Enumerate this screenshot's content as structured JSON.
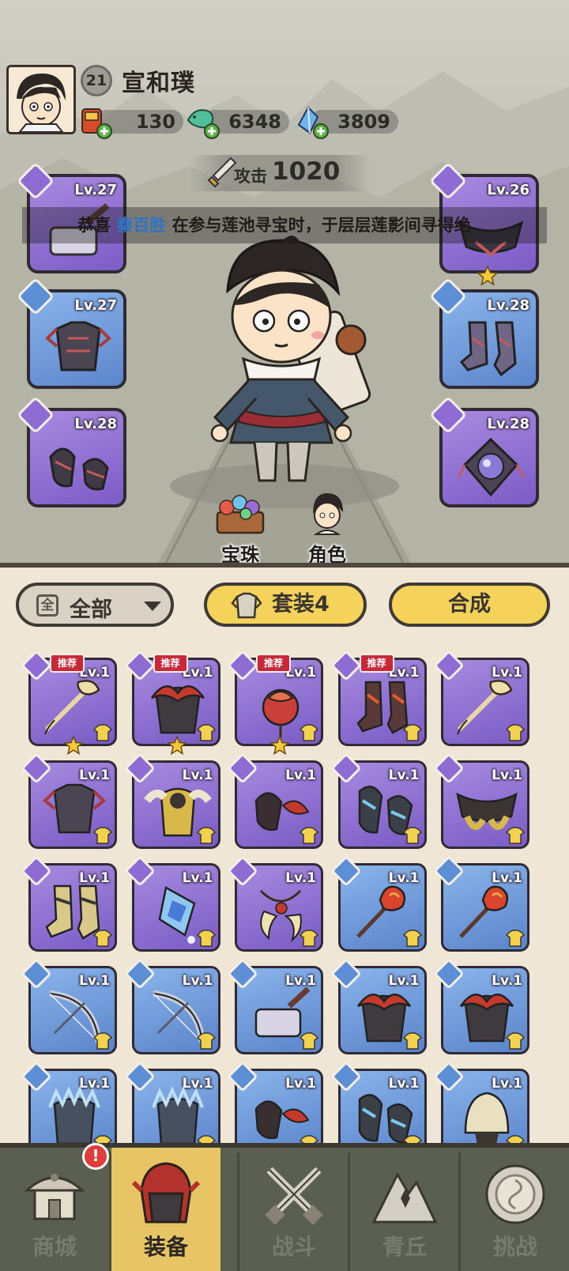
{
  "player": {
    "level": "21",
    "name": "宣和璞",
    "avatar_icon": "hero-portrait-icon"
  },
  "resources": [
    {
      "name": "scroll-bag",
      "value": "130",
      "icon": "red-scroll-bag-icon"
    },
    {
      "name": "jade-dragon",
      "value": "6348",
      "icon": "jade-dragon-icon"
    },
    {
      "name": "crystal",
      "value": "3809",
      "icon": "blue-crystal-icon"
    }
  ],
  "attack": {
    "label": "攻击",
    "value": "1020"
  },
  "broadcast": {
    "prefix": "恭喜",
    "player": "秦百胜",
    "message": "在参与莲池寻宝时，于层层莲影间寻得绝"
  },
  "equipped": {
    "left": [
      {
        "level": "Lv.27",
        "slot": "weapon",
        "item": "purple-hammer"
      },
      {
        "level": "Lv.27",
        "slot": "armor",
        "item": "dark-chest-armor"
      },
      {
        "level": "Lv.28",
        "slot": "bracer",
        "item": "dark-bracer"
      }
    ],
    "right": [
      {
        "level": "Lv.26",
        "slot": "belt",
        "item": "dark-belt",
        "starred": true
      },
      {
        "level": "Lv.28",
        "slot": "boots",
        "item": "dark-boots"
      },
      {
        "level": "Lv.28",
        "slot": "amulet",
        "item": "orb-amulet"
      }
    ]
  },
  "shortcuts": {
    "gems": "宝珠",
    "character": "角色"
  },
  "filters": {
    "all_icon_text": "全",
    "all_label": "全部",
    "set_label": "套装4",
    "craft_label": "合成"
  },
  "inventory": [
    {
      "level": "Lv.1",
      "rarity": "purple",
      "item": "gold-staff",
      "recommended": "推荐",
      "starred": true
    },
    {
      "level": "Lv.1",
      "rarity": "purple",
      "item": "red-flower-armor",
      "recommended": "推荐",
      "starred": true
    },
    {
      "level": "Lv.1",
      "rarity": "purple",
      "item": "red-lotus-amulet",
      "recommended": "推荐",
      "starred": true
    },
    {
      "level": "Lv.1",
      "rarity": "purple",
      "item": "flame-boots",
      "recommended": "推荐",
      "starred": false
    },
    {
      "level": "Lv.1",
      "rarity": "purple",
      "item": "gold-staff",
      "recommended": "",
      "starred": false
    },
    {
      "level": "Lv.1",
      "rarity": "purple",
      "item": "dark-chest-armor",
      "recommended": "",
      "starred": false
    },
    {
      "level": "Lv.1",
      "rarity": "purple",
      "item": "gold-feather-armor",
      "recommended": "",
      "starred": false
    },
    {
      "level": "Lv.1",
      "rarity": "purple",
      "item": "red-bracer",
      "recommended": "",
      "starred": false
    },
    {
      "level": "Lv.1",
      "rarity": "purple",
      "item": "ice-bracer",
      "recommended": "",
      "starred": false
    },
    {
      "level": "Lv.1",
      "rarity": "purple",
      "item": "gold-belt",
      "recommended": "",
      "starred": false
    },
    {
      "level": "Lv.1",
      "rarity": "purple",
      "item": "gold-boots",
      "recommended": "",
      "starred": false
    },
    {
      "level": "Lv.1",
      "rarity": "purple",
      "item": "ice-jade-pendant",
      "recommended": "",
      "starred": false
    },
    {
      "level": "Lv.1",
      "rarity": "purple",
      "item": "horn-necklace",
      "recommended": "",
      "starred": false
    },
    {
      "level": "Lv.1",
      "rarity": "blue",
      "item": "flame-staff",
      "recommended": "",
      "starred": false
    },
    {
      "level": "Lv.1",
      "rarity": "blue",
      "item": "flame-staff",
      "recommended": "",
      "starred": false
    },
    {
      "level": "Lv.1",
      "rarity": "blue",
      "item": "silver-bow",
      "recommended": "",
      "starred": false
    },
    {
      "level": "Lv.1",
      "rarity": "blue",
      "item": "silver-bow",
      "recommended": "",
      "starred": false
    },
    {
      "level": "Lv.1",
      "rarity": "blue",
      "item": "stone-hammer",
      "recommended": "",
      "starred": false
    },
    {
      "level": "Lv.1",
      "rarity": "blue",
      "item": "red-flower-armor",
      "recommended": "",
      "starred": false
    },
    {
      "level": "Lv.1",
      "rarity": "blue",
      "item": "red-flower-armor",
      "recommended": "",
      "starred": false
    },
    {
      "level": "Lv.1",
      "rarity": "blue",
      "item": "ice-spike-armor",
      "recommended": "",
      "starred": false
    },
    {
      "level": "Lv.1",
      "rarity": "blue",
      "item": "ice-spike-armor",
      "recommended": "",
      "starred": false
    },
    {
      "level": "Lv.1",
      "rarity": "blue",
      "item": "red-bracer",
      "recommended": "",
      "starred": false
    },
    {
      "level": "Lv.1",
      "rarity": "blue",
      "item": "ice-bracer",
      "recommended": "",
      "starred": false
    },
    {
      "level": "Lv.1",
      "rarity": "blue",
      "item": "gold-helm",
      "recommended": "",
      "starred": false
    }
  ],
  "nav": [
    {
      "label": "商城",
      "icon": "pagoda-shop-icon",
      "active": false,
      "alert": "!"
    },
    {
      "label": "装备",
      "icon": "red-helmet-icon",
      "active": true,
      "alert": ""
    },
    {
      "label": "战斗",
      "icon": "crossed-swords-icon",
      "active": false,
      "alert": ""
    },
    {
      "label": "青丘",
      "icon": "mountain-icon",
      "active": false,
      "alert": ""
    },
    {
      "label": "挑战",
      "icon": "drum-icon",
      "active": false,
      "alert": ""
    }
  ],
  "colors": {
    "purple_rarity": "#8e6cd3",
    "blue_rarity": "#5d8fd6",
    "accent_yellow": "#f5d35a",
    "highlight_name": "#2f74c4",
    "nav_active": "#e7c565"
  }
}
